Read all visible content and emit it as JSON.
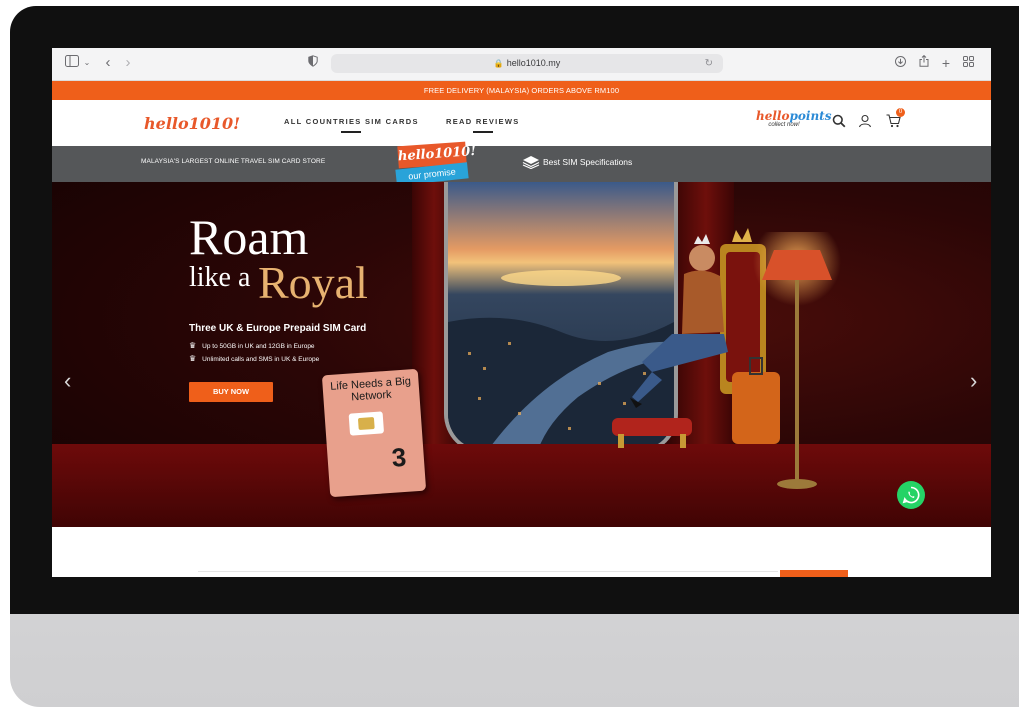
{
  "browser": {
    "url": "hello1010.my"
  },
  "promo": {
    "text": "FREE DELIVERY (MALAYSIA) ORDERS ABOVE RM100"
  },
  "nav": {
    "logo": "hello1010!",
    "links": [
      "ALL COUNTRIES SIM CARDS",
      "READ REVIEWS"
    ],
    "hellopoints_a": "hello",
    "hellopoints_b": "points",
    "hellopoints_tagline": "collect now!",
    "cart_count": "0"
  },
  "infobar": {
    "left_text": "MALAYSIA'S LARGEST ONLINE TRAVEL SIM CARD STORE",
    "promise_logo": "hello1010!",
    "promise_text": "our promise",
    "spec_text": "Best SIM Specifications"
  },
  "hero": {
    "title_1": "Roam",
    "title_2": "like a",
    "title_3": "Royal",
    "subtitle": "Three UK & Europe Prepaid SIM Card",
    "bullets": [
      "Up to 50GB in UK and 12GB in Europe",
      "Unlimited calls and SMS in UK & Europe"
    ],
    "cta": "BUY NOW",
    "sim_text": "Life Needs a Big Network",
    "sim_brand": "3",
    "prev": "‹",
    "next": "›"
  },
  "colors": {
    "brand_orange": "#ef5f1a",
    "gray_bar": "#555759",
    "promise_blue": "#29a3d9",
    "whatsapp": "#25d366"
  }
}
